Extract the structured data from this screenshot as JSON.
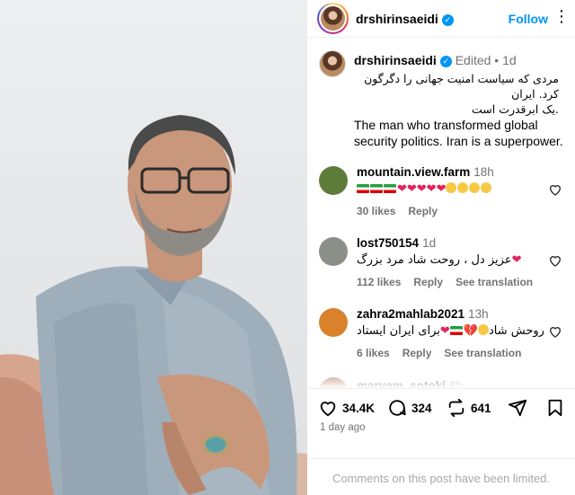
{
  "post": {
    "username": "drshirinsaeidi",
    "follow_label": "Follow",
    "more_label": "•••",
    "caption": {
      "username": "drshirinsaeidi",
      "edited": "Edited",
      "separator": "•",
      "time": "1d",
      "text_fa_line1": "مردی که سیاست امنیت جهانی را دگرگون کرد. ایران",
      "text_fa_line2": ".یک ابرقدرت است",
      "text_en": "The man who transformed global security politics. Iran is a superpower."
    },
    "comments": [
      {
        "username": "mountain.view.farm",
        "time": "18h",
        "likes": "30 likes",
        "reply": "Reply",
        "translate": "",
        "avatar_color": "#5e7d3a"
      },
      {
        "username": "lost750154",
        "time": "1d",
        "text": "عزیز دل ، روحت شاد مرد بزرگ",
        "likes": "112 likes",
        "reply": "Reply",
        "translate": "See translation",
        "avatar_color": "#8c8f88"
      },
      {
        "username": "zahra2mahlab2021",
        "time": "13h",
        "text_part1": "روحش شاد",
        "text_part2": "برای ایران ایستاد",
        "likes": "6 likes",
        "reply": "Reply",
        "translate": "See translation",
        "avatar_color": "#d9822b"
      },
      {
        "username": "maryam_sotoki",
        "time": "6h"
      }
    ],
    "actions": {
      "likes": "34.4K",
      "comments": "324",
      "reposts": "641"
    },
    "timestamp": "1 day ago",
    "footer": "Comments on this post have been limited."
  },
  "colors": {
    "accent": "#0095f6",
    "muted": "#737373",
    "heart": "#e0245e"
  },
  "icons": [
    "verified-icon",
    "heart-icon",
    "comment-icon",
    "repost-icon",
    "share-icon",
    "more-icon"
  ]
}
